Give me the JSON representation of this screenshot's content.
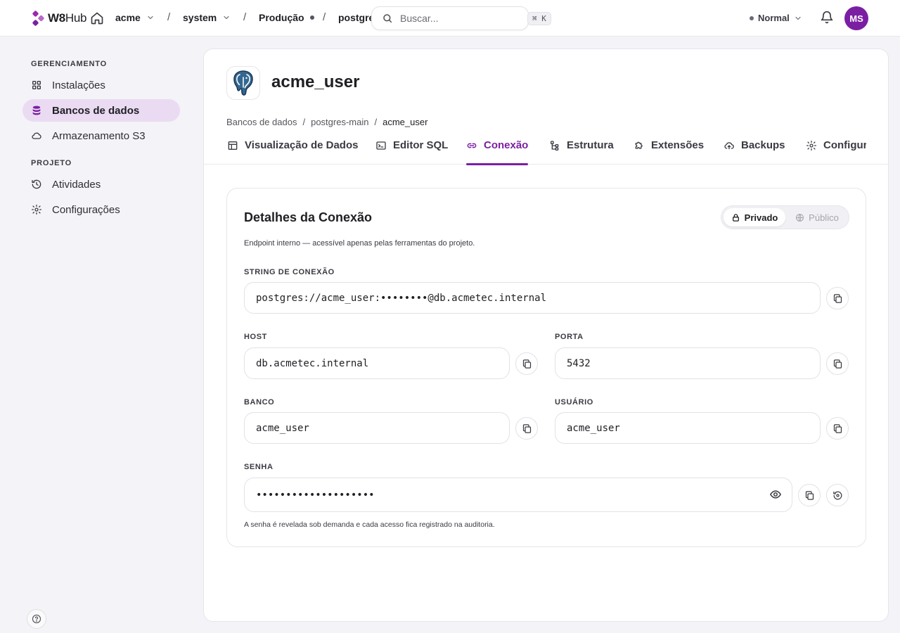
{
  "topbar": {
    "logo_bold": "W8",
    "logo_light": "Hub",
    "crumbs": [
      {
        "label": "acme",
        "has_menu": true
      },
      {
        "label": "system",
        "has_menu": true
      },
      {
        "label": "Produção",
        "has_menu": false
      },
      {
        "label": "postgres",
        "has_menu": false
      }
    ],
    "separator": "/",
    "search_placeholder": "Buscar...",
    "search_shortcut": "⌘ K",
    "mode_label": "Normal",
    "avatar_initials": "MS"
  },
  "sidebar": {
    "sections": [
      {
        "title": "GERENCIAMENTO",
        "items": [
          {
            "label": "Instalações",
            "icon": "grid-icon",
            "active": false
          },
          {
            "label": "Bancos de dados",
            "icon": "database-icon",
            "active": true
          },
          {
            "label": "Armazenamento S3",
            "icon": "cloud-icon",
            "active": false
          }
        ]
      },
      {
        "title": "PROJETO",
        "items": [
          {
            "label": "Atividades",
            "icon": "history-icon",
            "active": false
          },
          {
            "label": "Configurações",
            "icon": "gear-icon",
            "active": false
          }
        ]
      }
    ]
  },
  "page": {
    "title": "acme_user",
    "breadcrumb": [
      "Bancos de dados",
      "postgres-main",
      "acme_user"
    ],
    "breadcrumb_sep": "/",
    "tabs": [
      {
        "label": "Visualização de Dados",
        "icon": "table-icon",
        "active": false
      },
      {
        "label": "Editor SQL",
        "icon": "terminal-icon",
        "active": false
      },
      {
        "label": "Conexão",
        "icon": "link-icon",
        "active": true
      },
      {
        "label": "Estrutura",
        "icon": "tree-icon",
        "active": false
      },
      {
        "label": "Extensões",
        "icon": "puzzle-icon",
        "active": false
      },
      {
        "label": "Backups",
        "icon": "cloud-upload-icon",
        "active": false
      },
      {
        "label": "Configurações",
        "icon": "gear-icon",
        "active": false
      }
    ]
  },
  "connection": {
    "title": "Detalhes da Conexão",
    "description": "Endpoint interno — acessível apenas pelas ferramentas do projeto.",
    "visibility": {
      "private_label": "Privado",
      "public_label": "Público",
      "selected": "Privado"
    },
    "connection_string_label": "STRING DE CONEXÃO",
    "connection_string": "postgres://acme_user:••••••••@db.acmetec.internal",
    "host_label": "HOST",
    "host": "db.acmetec.internal",
    "port_label": "PORTA",
    "port": "5432",
    "database_label": "BANCO",
    "database": "acme_user",
    "user_label": "USUÁRIO",
    "user": "acme_user",
    "password_label": "SENHA",
    "password_masked": "••••••••••••••••••••",
    "password_hint": "A senha é revelada sob demanda e cada acesso fica registrado na auditoria."
  },
  "colors": {
    "accent": "#7b1fa2",
    "accent_soft": "#eadbf2",
    "background": "#f4f3f7"
  }
}
